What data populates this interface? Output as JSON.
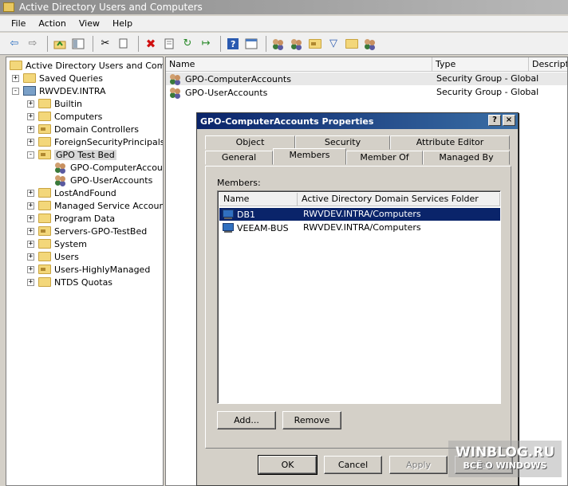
{
  "window": {
    "title": "Active Directory Users and Computers"
  },
  "menu": [
    "File",
    "Action",
    "View",
    "Help"
  ],
  "toolbar": {
    "icons": [
      "back-icon",
      "forward-icon",
      "up-folder-icon",
      "show-tree-icon",
      "cut-icon",
      "copy-icon",
      "delete-icon",
      "properties-icon",
      "refresh-icon",
      "export-icon",
      "help-icon",
      "mmc-icon",
      "new-user-icon",
      "new-group-icon",
      "new-ou-icon",
      "filter-icon",
      "find-icon",
      "add-to-group-icon"
    ]
  },
  "tree": {
    "root": "Active Directory Users and Comput",
    "saved_queries": "Saved Queries",
    "domain": "RWVDEV.INTRA",
    "items": [
      {
        "label": "Builtin",
        "type": "folder"
      },
      {
        "label": "Computers",
        "type": "folder"
      },
      {
        "label": "Domain Controllers",
        "type": "ou"
      },
      {
        "label": "ForeignSecurityPrincipals",
        "type": "folder"
      },
      {
        "label": "GPO Test Bed",
        "type": "ou",
        "expanded": true,
        "selected": true
      },
      {
        "label": "LostAndFound",
        "type": "folder"
      },
      {
        "label": "Managed Service Accounts",
        "type": "folder"
      },
      {
        "label": "Program Data",
        "type": "folder"
      },
      {
        "label": "Servers-GPO-TestBed",
        "type": "ou"
      },
      {
        "label": "System",
        "type": "folder"
      },
      {
        "label": "Users",
        "type": "folder"
      },
      {
        "label": "Users-HighlyManaged",
        "type": "ou"
      },
      {
        "label": "NTDS Quotas",
        "type": "folder"
      }
    ],
    "children": [
      "GPO-ComputerAccount",
      "GPO-UserAccounts"
    ]
  },
  "list": {
    "columns": [
      "Name",
      "Type",
      "Descriptio"
    ],
    "rows": [
      {
        "name": "GPO-ComputerAccounts",
        "type": "Security Group - Global"
      },
      {
        "name": "GPO-UserAccounts",
        "type": "Security Group - Global"
      }
    ]
  },
  "dialog": {
    "title": "GPO-ComputerAccounts Properties",
    "help_btn": "?",
    "close_btn": "×",
    "tabs_back": [
      "Object",
      "Security",
      "Attribute Editor"
    ],
    "tabs_front": [
      "General",
      "Members",
      "Member Of",
      "Managed By"
    ],
    "members_label": "Members:",
    "member_columns": [
      "Name",
      "Active Directory Domain Services Folder"
    ],
    "members": [
      {
        "name": "DB1",
        "folder": "RWVDEV.INTRA/Computers"
      },
      {
        "name": "VEEAM-BUS",
        "folder": "RWVDEV.INTRA/Computers"
      }
    ],
    "add_label": "Add...",
    "remove_label": "Remove",
    "ok_label": "OK",
    "cancel_label": "Cancel",
    "apply_label": "Apply",
    "help_label": "Help"
  },
  "watermark": {
    "line1": "WINBLOG.RU",
    "line2": "ВСЁ О WINDOWS"
  }
}
